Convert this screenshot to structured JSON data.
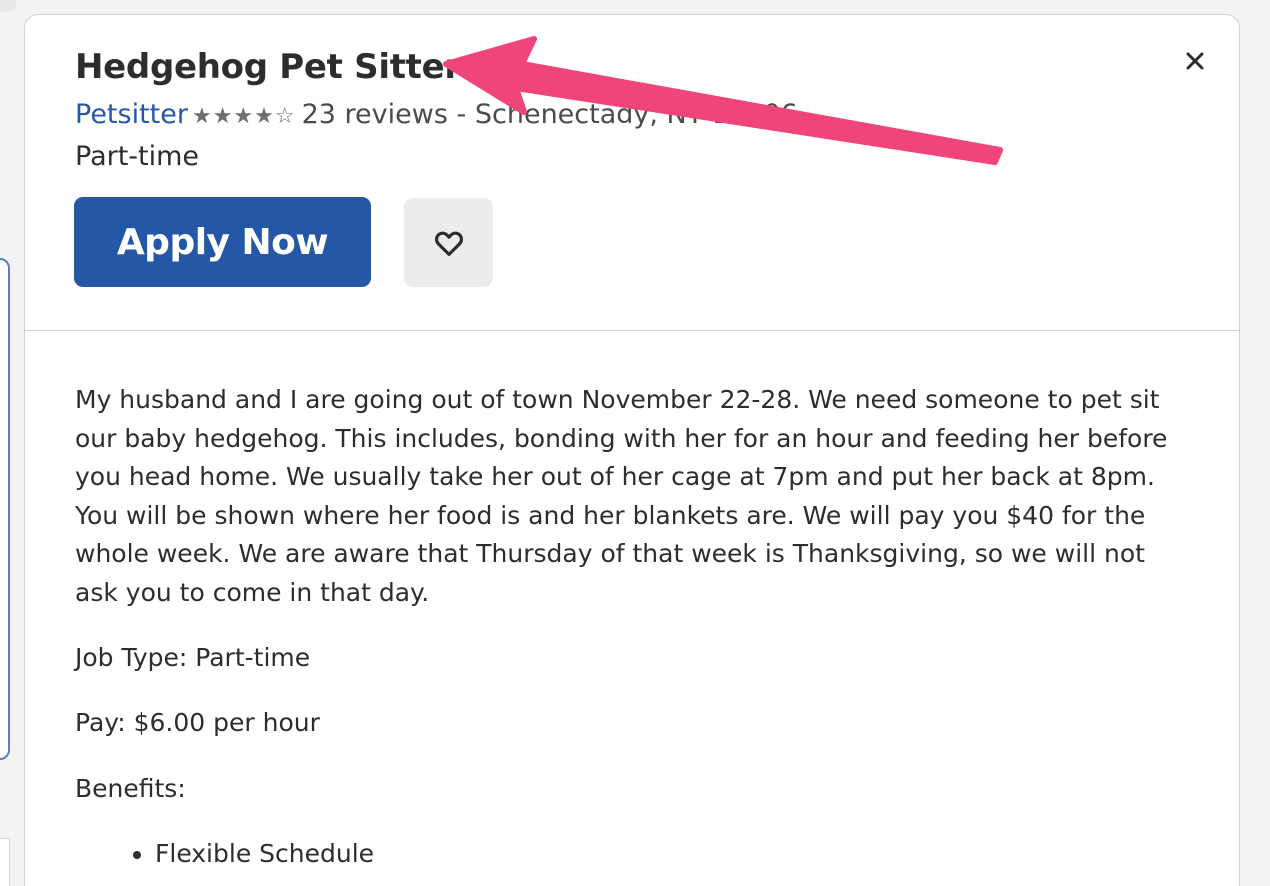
{
  "job": {
    "title": "Hedgehog Pet Sitter",
    "company": "Petsitter",
    "rating_stars": "★★★★☆",
    "rating_value": 4,
    "reviews": "23 reviews",
    "location_separator": "-",
    "location": "Schenectady, NY 12306",
    "job_type": "Part-time"
  },
  "actions": {
    "apply_label": "Apply Now",
    "save_icon": "heart-outline-icon",
    "close_icon": "close-icon",
    "close_glyph": "✕"
  },
  "details": {
    "description": "My husband and I are going out of town November 22-28. We need someone to pet sit our baby hedgehog. This includes, bonding with her for an hour and feeding her before you head home. We usually take her out of her cage at 7pm and put her back at 8pm. You will be shown where her food is and her blankets are. We will pay you $40 for the whole week. We are aware that Thursday of that week is Thanksgiving, so we will not ask you to come in that day.",
    "job_type_line": "Job Type: Part-time",
    "pay_line": "Pay: $6.00 per hour",
    "benefits_heading": "Benefits:",
    "benefits": [
      "Flexible Schedule"
    ]
  },
  "colors": {
    "brand_blue": "#2557a7",
    "annotation_arrow": "#f0457a",
    "save_button_bg": "#ececec"
  }
}
